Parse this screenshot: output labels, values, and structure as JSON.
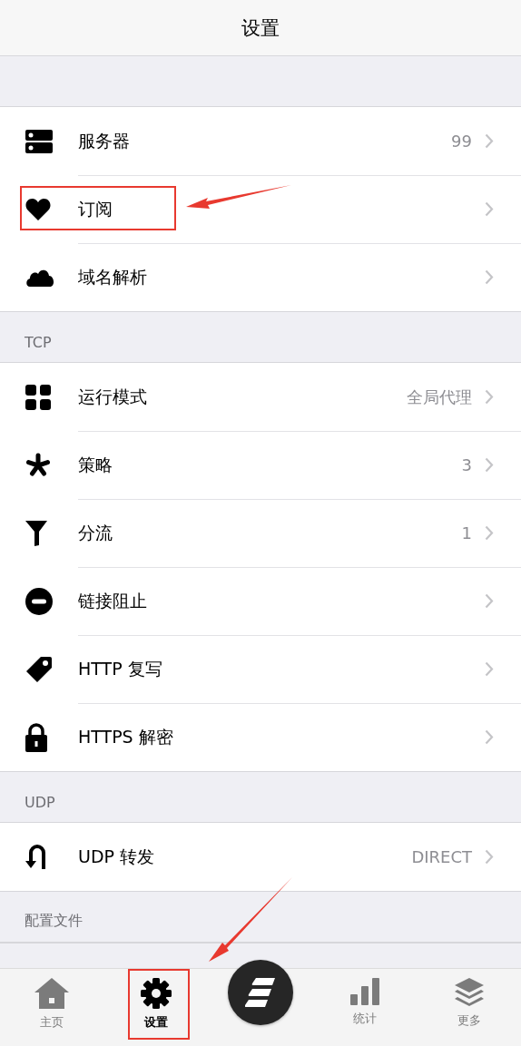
{
  "title": "设置",
  "sections": [
    {
      "items": [
        {
          "label": "服务器",
          "value": "99",
          "highlighted": false
        },
        {
          "label": "订阅",
          "highlighted": true
        },
        {
          "label": "域名解析",
          "highlighted": false
        }
      ]
    },
    {
      "header": "TCP",
      "items": [
        {
          "label": "运行模式",
          "value": "全局代理",
          "highlighted": false
        },
        {
          "label": "策略",
          "value": "3",
          "highlighted": false
        },
        {
          "label": "分流",
          "value": "1",
          "highlighted": false
        },
        {
          "label": "链接阻止",
          "highlighted": false
        },
        {
          "label": "HTTP 复写",
          "highlighted": false
        },
        {
          "label": "HTTPS 解密",
          "highlighted": false
        }
      ]
    },
    {
      "header": "UDP",
      "items": [
        {
          "label": "UDP 转发",
          "value": "DIRECT",
          "highlighted": false
        }
      ]
    },
    {
      "header": "配置文件"
    }
  ],
  "tabs": [
    {
      "kind": "tab",
      "label": "主页",
      "selected": false,
      "highlighted": false
    },
    {
      "kind": "tab",
      "label": "设置",
      "selected": true,
      "highlighted": true
    },
    {
      "kind": "center"
    },
    {
      "kind": "tab",
      "label": "统计",
      "selected": false,
      "highlighted": false
    },
    {
      "kind": "tab",
      "label": "更多",
      "selected": false,
      "highlighted": false
    }
  ]
}
